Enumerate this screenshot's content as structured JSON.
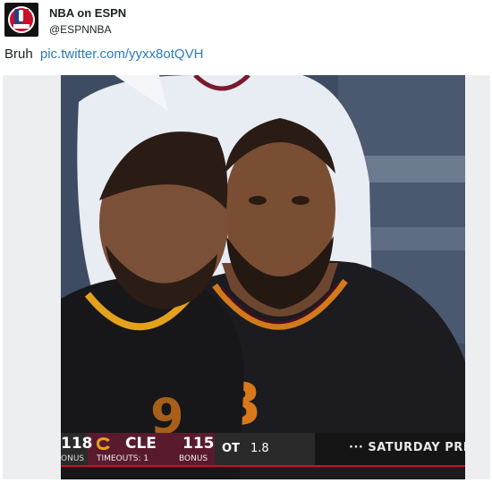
{
  "tweet": {
    "author_name": "NBA on ESPN",
    "author_handle": "@ESPNNBA",
    "text": "Bruh",
    "link": "pic.twitter.com/yyxx8otQVH"
  },
  "scoreboard": {
    "left_score": "118",
    "left_sub": "ONUS",
    "team": "CLE",
    "timeouts": "TIMEOUTS: 1",
    "team_score": "115",
    "bonus": "BONUS",
    "period": "OT",
    "clock": "1.8",
    "promo": "··· SATURDAY PRI"
  },
  "colors": {
    "link": "#2b7bb9",
    "cavs_wine": "#5a1a2e",
    "jersey_gold": "#e07b1c"
  }
}
